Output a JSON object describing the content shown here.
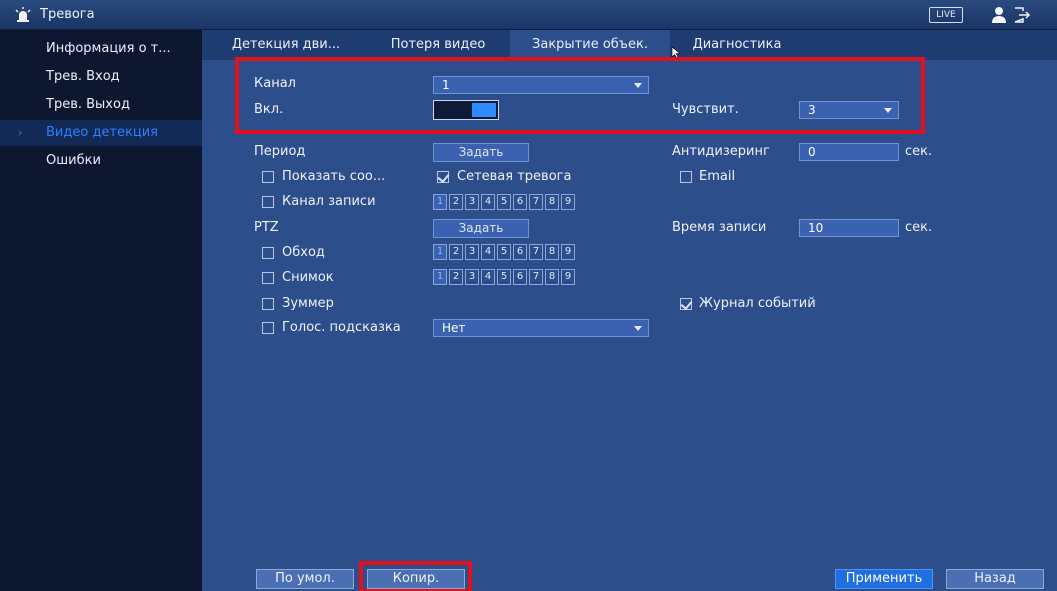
{
  "window": {
    "title": "Тревога",
    "live_label": "LIVE",
    "icons": [
      "alarm-icon",
      "user-icon",
      "logout-icon"
    ]
  },
  "sidebar": {
    "items": [
      {
        "label": "Информация о т..."
      },
      {
        "label": "Трев. Вход"
      },
      {
        "label": "Трев. Выход"
      },
      {
        "label": "Видео детекция",
        "active": true
      },
      {
        "label": "Ошибки"
      }
    ]
  },
  "tabs": [
    {
      "label": "Детекция дви..."
    },
    {
      "label": "Потеря видео"
    },
    {
      "label": "Закрытие объек.",
      "active": true
    },
    {
      "label": "Диагностика"
    }
  ],
  "form": {
    "channel_label": "Канал",
    "channel_value": "1",
    "enable_label": "Вкл.",
    "enable_on": true,
    "sensitivity_label": "Чувствит.",
    "sensitivity_value": "3",
    "period_label": "Период",
    "set_label": "Задать",
    "antidither_label": "Антидизеринг",
    "antidither_value": "0",
    "sec_label": "сек.",
    "show_message_label": "Показать соо...",
    "show_message_checked": false,
    "network_alarm_label": "Сетевая тревога",
    "network_alarm_checked": true,
    "email_label": "Email",
    "email_checked": false,
    "record_channel_label": "Канал записи",
    "record_channel_checked": false,
    "channels": [
      "1",
      "2",
      "3",
      "4",
      "5",
      "6",
      "7",
      "8",
      "9"
    ],
    "ptz_label": "PTZ",
    "ptz_set_label": "Задать",
    "record_time_label": "Время записи",
    "record_time_value": "10",
    "tour_label": "Обход",
    "tour_checked": false,
    "snapshot_label": "Снимок",
    "snapshot_checked": false,
    "buzzer_label": "Зуммер",
    "buzzer_checked": false,
    "event_log_label": "Журнал событий",
    "event_log_checked": true,
    "voice_prompt_label": "Голос. подсказка",
    "voice_prompt_checked": false,
    "voice_prompt_value": "Нет"
  },
  "footer": {
    "default_label": "По умол.",
    "copy_label": "Копир.",
    "apply_label": "Применить",
    "back_label": "Назад"
  },
  "colors": {
    "highlight": "#e0101e",
    "accent": "#2e7fff"
  }
}
